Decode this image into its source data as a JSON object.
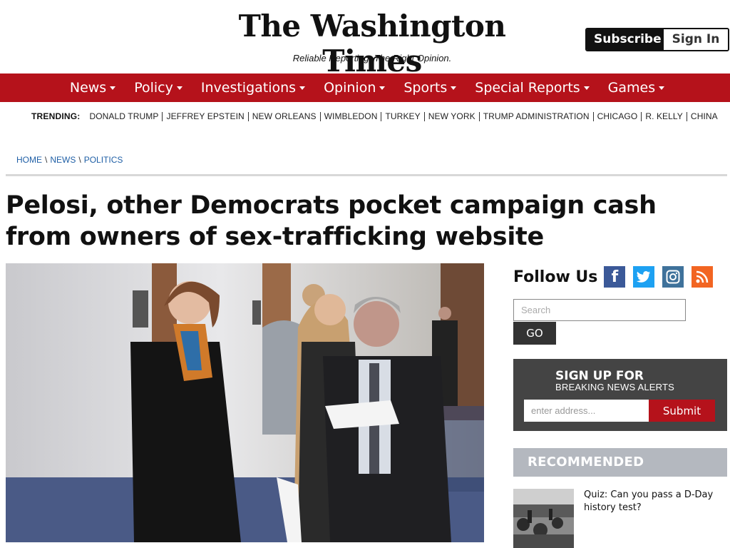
{
  "header": {
    "logo": "The Washington Times",
    "tagline": "Reliable Reporting. The Right Opinion.",
    "subscribe_label": "Subscribe",
    "signin_label": "Sign In"
  },
  "nav": {
    "items": [
      {
        "label": "News"
      },
      {
        "label": "Policy"
      },
      {
        "label": "Investigations"
      },
      {
        "label": "Opinion"
      },
      {
        "label": "Sports"
      },
      {
        "label": "Special Reports"
      },
      {
        "label": "Games"
      }
    ]
  },
  "trending": {
    "label": "TRENDING:",
    "items": [
      "DONALD TRUMP",
      "JEFFREY EPSTEIN",
      "NEW ORLEANS",
      "WIMBLEDON",
      "TURKEY",
      "NEW YORK",
      "TRUMP ADMINISTRATION",
      "CHICAGO",
      "R. KELLY",
      "CHINA"
    ]
  },
  "breadcrumb": {
    "items": [
      "HOME",
      "NEWS",
      "POLITICS"
    ],
    "separator": "\\"
  },
  "article": {
    "headline": "Pelosi, other Democrats pocket campaign cash from owners of sex-trafficking website"
  },
  "sidebar": {
    "follow_title": "Follow Us",
    "search_placeholder": "Search",
    "go_label": "GO",
    "signup_title": "SIGN UP FOR",
    "signup_subtitle": "BREAKING NEWS ALERTS",
    "email_placeholder": "enter address...",
    "submit_label": "Submit",
    "recommended_title": "RECOMMENDED",
    "recommended_item": "Quiz: Can you pass a D-Day history test?"
  },
  "colors": {
    "brand_red": "#b5121b",
    "facebook": "#3b5998",
    "twitter": "#1da1f2",
    "instagram": "#3f729b",
    "rss": "#f26522"
  }
}
